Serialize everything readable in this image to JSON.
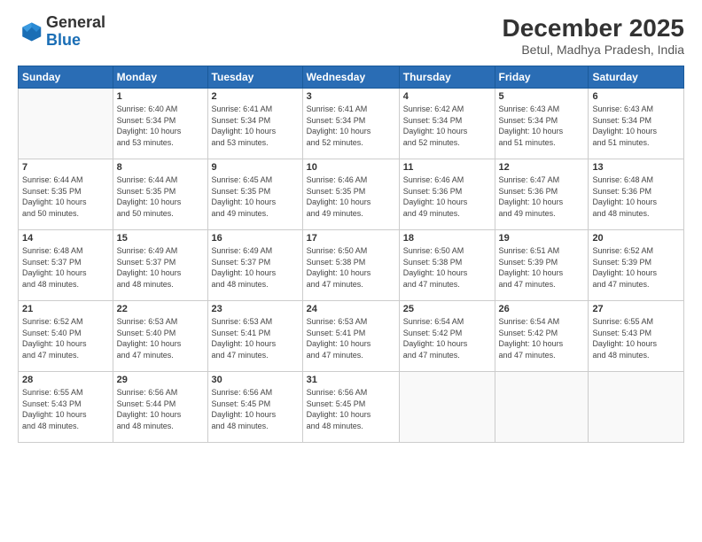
{
  "logo": {
    "line1": "General",
    "line2": "Blue"
  },
  "header": {
    "title": "December 2025",
    "subtitle": "Betul, Madhya Pradesh, India"
  },
  "weekdays": [
    "Sunday",
    "Monday",
    "Tuesday",
    "Wednesday",
    "Thursday",
    "Friday",
    "Saturday"
  ],
  "weeks": [
    [
      {
        "day": "",
        "info": ""
      },
      {
        "day": "1",
        "info": "Sunrise: 6:40 AM\nSunset: 5:34 PM\nDaylight: 10 hours\nand 53 minutes."
      },
      {
        "day": "2",
        "info": "Sunrise: 6:41 AM\nSunset: 5:34 PM\nDaylight: 10 hours\nand 53 minutes."
      },
      {
        "day": "3",
        "info": "Sunrise: 6:41 AM\nSunset: 5:34 PM\nDaylight: 10 hours\nand 52 minutes."
      },
      {
        "day": "4",
        "info": "Sunrise: 6:42 AM\nSunset: 5:34 PM\nDaylight: 10 hours\nand 52 minutes."
      },
      {
        "day": "5",
        "info": "Sunrise: 6:43 AM\nSunset: 5:34 PM\nDaylight: 10 hours\nand 51 minutes."
      },
      {
        "day": "6",
        "info": "Sunrise: 6:43 AM\nSunset: 5:34 PM\nDaylight: 10 hours\nand 51 minutes."
      }
    ],
    [
      {
        "day": "7",
        "info": "Sunrise: 6:44 AM\nSunset: 5:35 PM\nDaylight: 10 hours\nand 50 minutes."
      },
      {
        "day": "8",
        "info": "Sunrise: 6:44 AM\nSunset: 5:35 PM\nDaylight: 10 hours\nand 50 minutes."
      },
      {
        "day": "9",
        "info": "Sunrise: 6:45 AM\nSunset: 5:35 PM\nDaylight: 10 hours\nand 49 minutes."
      },
      {
        "day": "10",
        "info": "Sunrise: 6:46 AM\nSunset: 5:35 PM\nDaylight: 10 hours\nand 49 minutes."
      },
      {
        "day": "11",
        "info": "Sunrise: 6:46 AM\nSunset: 5:36 PM\nDaylight: 10 hours\nand 49 minutes."
      },
      {
        "day": "12",
        "info": "Sunrise: 6:47 AM\nSunset: 5:36 PM\nDaylight: 10 hours\nand 49 minutes."
      },
      {
        "day": "13",
        "info": "Sunrise: 6:48 AM\nSunset: 5:36 PM\nDaylight: 10 hours\nand 48 minutes."
      }
    ],
    [
      {
        "day": "14",
        "info": "Sunrise: 6:48 AM\nSunset: 5:37 PM\nDaylight: 10 hours\nand 48 minutes."
      },
      {
        "day": "15",
        "info": "Sunrise: 6:49 AM\nSunset: 5:37 PM\nDaylight: 10 hours\nand 48 minutes."
      },
      {
        "day": "16",
        "info": "Sunrise: 6:49 AM\nSunset: 5:37 PM\nDaylight: 10 hours\nand 48 minutes."
      },
      {
        "day": "17",
        "info": "Sunrise: 6:50 AM\nSunset: 5:38 PM\nDaylight: 10 hours\nand 47 minutes."
      },
      {
        "day": "18",
        "info": "Sunrise: 6:50 AM\nSunset: 5:38 PM\nDaylight: 10 hours\nand 47 minutes."
      },
      {
        "day": "19",
        "info": "Sunrise: 6:51 AM\nSunset: 5:39 PM\nDaylight: 10 hours\nand 47 minutes."
      },
      {
        "day": "20",
        "info": "Sunrise: 6:52 AM\nSunset: 5:39 PM\nDaylight: 10 hours\nand 47 minutes."
      }
    ],
    [
      {
        "day": "21",
        "info": "Sunrise: 6:52 AM\nSunset: 5:40 PM\nDaylight: 10 hours\nand 47 minutes."
      },
      {
        "day": "22",
        "info": "Sunrise: 6:53 AM\nSunset: 5:40 PM\nDaylight: 10 hours\nand 47 minutes."
      },
      {
        "day": "23",
        "info": "Sunrise: 6:53 AM\nSunset: 5:41 PM\nDaylight: 10 hours\nand 47 minutes."
      },
      {
        "day": "24",
        "info": "Sunrise: 6:53 AM\nSunset: 5:41 PM\nDaylight: 10 hours\nand 47 minutes."
      },
      {
        "day": "25",
        "info": "Sunrise: 6:54 AM\nSunset: 5:42 PM\nDaylight: 10 hours\nand 47 minutes."
      },
      {
        "day": "26",
        "info": "Sunrise: 6:54 AM\nSunset: 5:42 PM\nDaylight: 10 hours\nand 47 minutes."
      },
      {
        "day": "27",
        "info": "Sunrise: 6:55 AM\nSunset: 5:43 PM\nDaylight: 10 hours\nand 48 minutes."
      }
    ],
    [
      {
        "day": "28",
        "info": "Sunrise: 6:55 AM\nSunset: 5:43 PM\nDaylight: 10 hours\nand 48 minutes."
      },
      {
        "day": "29",
        "info": "Sunrise: 6:56 AM\nSunset: 5:44 PM\nDaylight: 10 hours\nand 48 minutes."
      },
      {
        "day": "30",
        "info": "Sunrise: 6:56 AM\nSunset: 5:45 PM\nDaylight: 10 hours\nand 48 minutes."
      },
      {
        "day": "31",
        "info": "Sunrise: 6:56 AM\nSunset: 5:45 PM\nDaylight: 10 hours\nand 48 minutes."
      },
      {
        "day": "",
        "info": ""
      },
      {
        "day": "",
        "info": ""
      },
      {
        "day": "",
        "info": ""
      }
    ]
  ]
}
